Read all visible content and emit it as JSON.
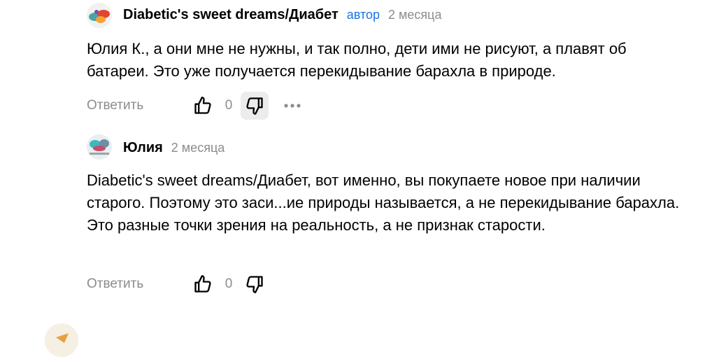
{
  "comments": [
    {
      "author": "Diabetic's sweet dreams/Диабет",
      "badge": "автор",
      "date": "2 месяца",
      "text": "Юлия К., а они мне не нужны, и так полно, дети ими не рисуют, а плавят об батареи. Это уже получается перекидывание барахла в природе.",
      "reply_label": "Ответить",
      "likes": "0",
      "avatar_icon": "candy-avatar-icon"
    },
    {
      "author": "Юлия",
      "date": "2 месяца",
      "text": "Diabetic's sweet dreams/Диабет, вот именно, вы покупаете новое при наличии старого. Поэтому это заси...ие природы называется, а не перекидывание барахла. Это разные точки зрения на реальность, а не признак старости.",
      "reply_label": "Ответить",
      "likes": "0",
      "avatar_icon": "photo-avatar-icon"
    }
  ],
  "icons": {
    "like": "thumbs-up-icon",
    "dislike": "thumbs-down-icon",
    "more": "more-dots-icon"
  },
  "colors": {
    "meta": "#8c8c8c",
    "author_badge": "#1a73e8",
    "active_button": "#ececec"
  }
}
